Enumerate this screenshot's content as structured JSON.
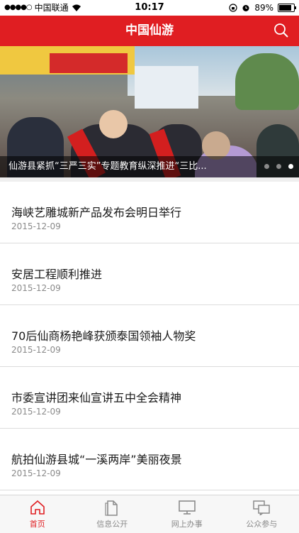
{
  "status_bar": {
    "carrier": "中国联通",
    "time": "10:17",
    "battery": "89%",
    "icons": [
      "signal-dots-icon",
      "wifi-icon",
      "orientation-lock-icon",
      "alarm-icon",
      "battery-icon"
    ]
  },
  "header": {
    "title": "中国仙游",
    "search_icon": "search-icon",
    "color": "#e01e22"
  },
  "banner": {
    "caption": "仙游县紧抓“三严三实”专题教育纵深推进“三比...",
    "pages": 3,
    "active_page": 3
  },
  "news": [
    {
      "title": "海峡艺雕城新产品发布会明日举行",
      "date": "2015-12-09"
    },
    {
      "title": "安居工程顺利推进",
      "date": "2015-12-09"
    },
    {
      "title": "70后仙商杨艳峰获颁泰国领袖人物奖",
      "date": "2015-12-09"
    },
    {
      "title": "市委宣讲团来仙宣讲五中全会精神",
      "date": "2015-12-09"
    },
    {
      "title": "航拍仙游县城“一溪两岸”美丽夜景",
      "date": "2015-12-09"
    }
  ],
  "tabs": [
    {
      "label": "首页",
      "icon": "home-icon",
      "active": true
    },
    {
      "label": "信息公开",
      "icon": "document-icon",
      "active": false
    },
    {
      "label": "网上办事",
      "icon": "monitor-icon",
      "active": false
    },
    {
      "label": "公众参与",
      "icon": "chat-icon",
      "active": false
    }
  ],
  "colors": {
    "accent": "#e01e22",
    "inactive": "#8a8a8a"
  }
}
